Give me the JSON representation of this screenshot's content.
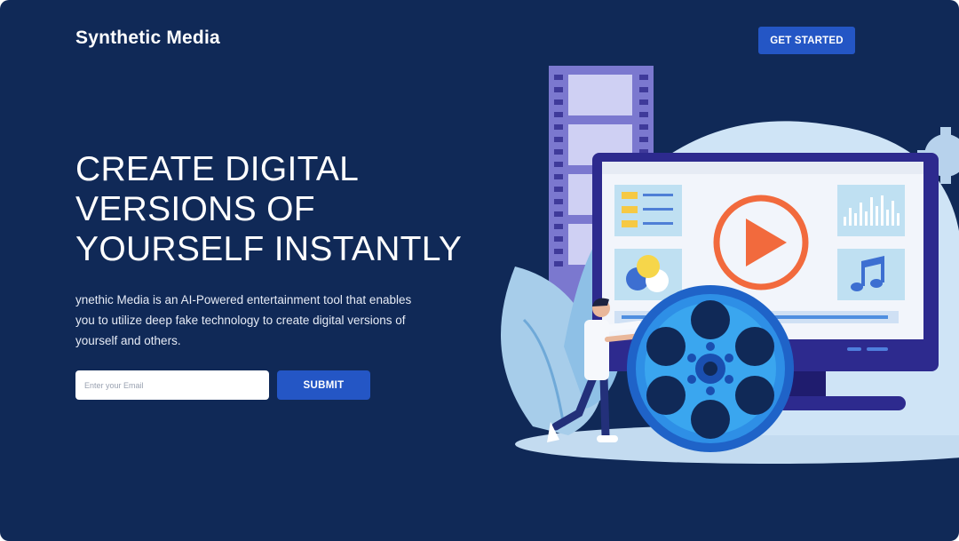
{
  "header": {
    "brand": "Synthetic Media",
    "cta_label": "GET STARTED"
  },
  "hero": {
    "headline_lines": [
      "CREATE DIGITAL",
      "VERSIONS OF",
      "YOURSELF INSTANTLY"
    ],
    "description": "ynethic Media is an AI-Powered entertainment tool that enables you to utilize deep fake technology to create digital versions of yourself and others.",
    "email_placeholder": "Enter your Email",
    "email_value": "",
    "submit_label": "SUBMIT"
  },
  "illustration": {
    "icons": [
      "film-strip-icon",
      "monitor-icon",
      "play-icon",
      "audio-bars-icon",
      "music-note-icon",
      "color-circles-icon",
      "film-reel-icon",
      "gear-icon",
      "leaf-icon",
      "person-figure"
    ]
  },
  "colors": {
    "background": "#102957",
    "accent": "#2456c5",
    "play": "#f26a3d"
  }
}
